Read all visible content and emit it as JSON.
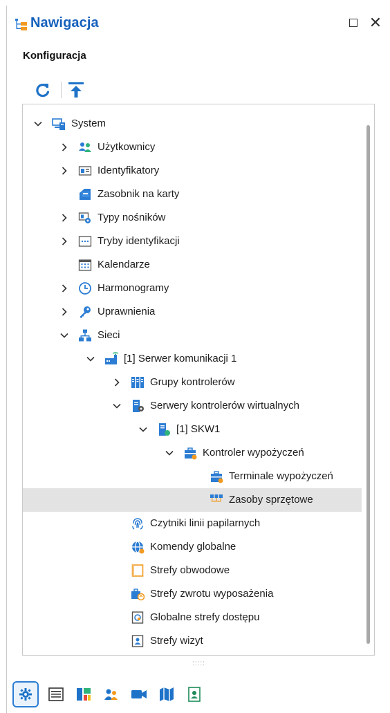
{
  "panel": {
    "title": "Nawigacja",
    "section": "Konfiguracja"
  },
  "colors": {
    "title_blue": "#1560bd",
    "accent_blue": "#2b7cd3",
    "selection": "#e3e3e3"
  },
  "tree": [
    {
      "label": "System",
      "level": 0,
      "chevron": "expanded",
      "icon": "system-icon"
    },
    {
      "label": "Użytkownicy",
      "level": 1,
      "chevron": "collapsed",
      "icon": "users-icon"
    },
    {
      "label": "Identyfikatory",
      "level": 1,
      "chevron": "collapsed",
      "icon": "id-card-icon"
    },
    {
      "label": "Zasobnik na karty",
      "level": 1,
      "chevron": "none",
      "icon": "card-stack-icon"
    },
    {
      "label": "Typy nośników",
      "level": 1,
      "chevron": "collapsed",
      "icon": "carrier-types-icon"
    },
    {
      "label": "Tryby identyfikacji",
      "level": 1,
      "chevron": "collapsed",
      "icon": "id-mode-icon"
    },
    {
      "label": "Kalendarze",
      "level": 1,
      "chevron": "none",
      "icon": "calendar-icon"
    },
    {
      "label": "Harmonogramy",
      "level": 1,
      "chevron": "collapsed",
      "icon": "clock-icon"
    },
    {
      "label": "Uprawnienia",
      "level": 1,
      "chevron": "collapsed",
      "icon": "key-icon"
    },
    {
      "label": "Sieci",
      "level": 1,
      "chevron": "expanded",
      "icon": "network-icon"
    },
    {
      "label": "[1] Serwer komunikacji 1",
      "level": 2,
      "chevron": "expanded",
      "icon": "comm-server-icon"
    },
    {
      "label": "Grupy kontrolerów",
      "level": 3,
      "chevron": "collapsed",
      "icon": "controller-groups-icon"
    },
    {
      "label": "Serwery kontrolerów wirtualnych",
      "level": 3,
      "chevron": "expanded",
      "icon": "virtual-servers-icon"
    },
    {
      "label": "[1] SKW1",
      "level": 4,
      "chevron": "expanded",
      "icon": "skw-server-icon"
    },
    {
      "label": "Kontroler wypożyczeń",
      "level": 5,
      "chevron": "expanded",
      "icon": "rental-controller-icon"
    },
    {
      "label": "Terminale wypożyczeń",
      "level": 6,
      "chevron": "none",
      "icon": "rental-terminal-icon"
    },
    {
      "label": "Zasoby sprzętowe",
      "level": 6,
      "chevron": "none",
      "icon": "hardware-resources-icon",
      "selected": true
    },
    {
      "label": "Czytniki linii papilarnych",
      "level": 3,
      "chevron": "none",
      "icon": "fingerprint-icon"
    },
    {
      "label": "Komendy globalne",
      "level": 3,
      "chevron": "none",
      "icon": "globe-command-icon"
    },
    {
      "label": "Strefy obwodowe",
      "level": 3,
      "chevron": "none",
      "icon": "perimeter-zone-icon"
    },
    {
      "label": "Strefy zwrotu wyposażenia",
      "level": 3,
      "chevron": "none",
      "icon": "return-zone-icon"
    },
    {
      "label": "Globalne strefy dostępu",
      "level": 3,
      "chevron": "none",
      "icon": "global-access-zone-icon"
    },
    {
      "label": "Strefy wizyt",
      "level": 3,
      "chevron": "none",
      "icon": "visit-zone-icon"
    }
  ],
  "bottom_tabs": [
    {
      "icon": "gear-icon",
      "active": true
    },
    {
      "icon": "list-icon",
      "active": false
    },
    {
      "icon": "dashboard-icon",
      "active": false
    },
    {
      "icon": "people-icon",
      "active": false
    },
    {
      "icon": "camera-icon",
      "active": false
    },
    {
      "icon": "map-icon",
      "active": false
    },
    {
      "icon": "badge-icon",
      "active": false
    }
  ]
}
